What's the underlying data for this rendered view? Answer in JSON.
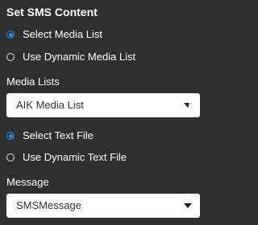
{
  "panel": {
    "title": "Set SMS Content"
  },
  "media_source": {
    "options": [
      {
        "label": "Select Media List",
        "selected": true
      },
      {
        "label": "Use Dynamic Media List",
        "selected": false
      }
    ]
  },
  "media_lists": {
    "label": "Media Lists",
    "selected_value": "AIK Media List",
    "refresh_icon": "refresh-icon"
  },
  "text_source": {
    "options": [
      {
        "label": "Select Text File",
        "selected": true
      },
      {
        "label": "Use Dynamic Text File",
        "selected": false
      }
    ]
  },
  "message": {
    "label": "Message",
    "selected_value": "SMSMessage"
  },
  "colors": {
    "background": "#2f2f2f",
    "accent": "#2d8fe6",
    "text": "#ffffff"
  }
}
